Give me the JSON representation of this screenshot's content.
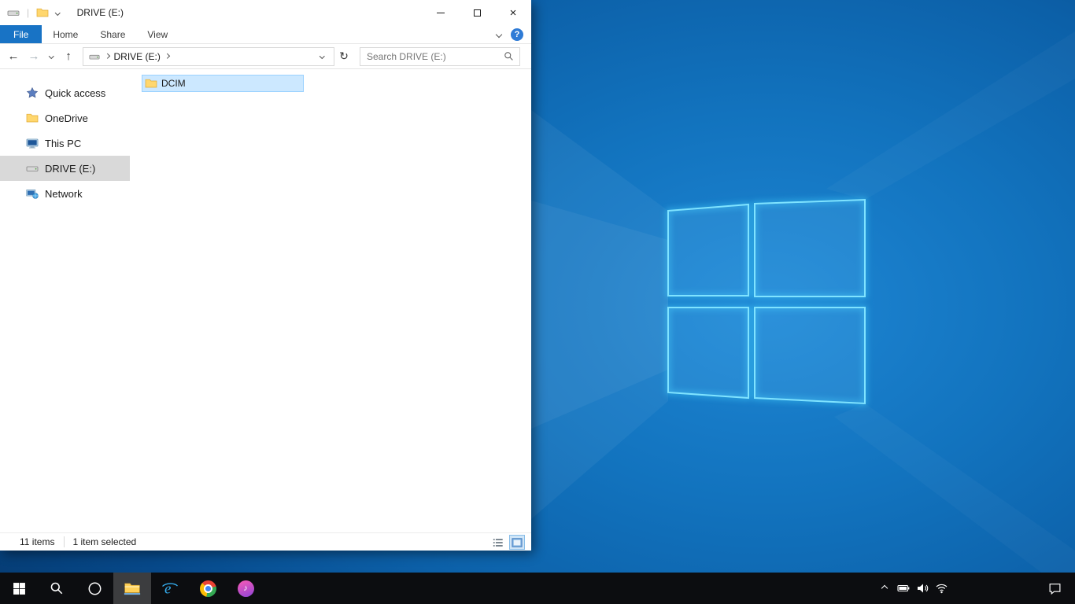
{
  "window": {
    "title": "DRIVE (E:)"
  },
  "ribbon": {
    "tabs": [
      "File",
      "Home",
      "Share",
      "View"
    ],
    "help_label": "?"
  },
  "navigation": {
    "breadcrumb": {
      "location": "DRIVE (E:)"
    },
    "search": {
      "placeholder": "Search DRIVE (E:)",
      "value": ""
    }
  },
  "sidebar": {
    "items": [
      {
        "label": "Quick access",
        "icon": "star-icon",
        "selected": false
      },
      {
        "label": "OneDrive",
        "icon": "folder-icon",
        "selected": false
      },
      {
        "label": "This PC",
        "icon": "computer-icon",
        "selected": false
      },
      {
        "label": "DRIVE (E:)",
        "icon": "drive-icon",
        "selected": true
      },
      {
        "label": "Network",
        "icon": "network-icon",
        "selected": false
      }
    ]
  },
  "files": {
    "items": [
      {
        "name": "DCIM",
        "icon": "folder-icon",
        "selected": true
      }
    ]
  },
  "status_bar": {
    "item_count": "11 items",
    "selection": "1 item selected"
  },
  "glyphs": {
    "separator": "|",
    "back": "←",
    "forward": "→",
    "up": "↑",
    "refresh": "↻",
    "close": "×",
    "ie": "e",
    "music_note": "♪"
  },
  "colors": {
    "accent_blue": "#1873c5",
    "selection_fill": "#cce8ff",
    "selection_border": "#99d1ff",
    "sidebar_selected": "#d9d9d9",
    "taskbar": "#0c0d10",
    "wallpaper_blue": "#0c60a8",
    "logo_stroke": "#45d6ff"
  },
  "taskbar": {
    "items": [
      {
        "name": "start-button"
      },
      {
        "name": "search-button"
      },
      {
        "name": "cortana-button"
      },
      {
        "name": "file-explorer-button",
        "active": true
      },
      {
        "name": "internet-explorer-button"
      },
      {
        "name": "chrome-button"
      },
      {
        "name": "itunes-button"
      }
    ],
    "tray": [
      {
        "name": "hidden-icons-chevron"
      },
      {
        "name": "battery-icon"
      },
      {
        "name": "volume-icon"
      },
      {
        "name": "wifi-icon"
      },
      {
        "name": "action-center-icon"
      }
    ]
  }
}
